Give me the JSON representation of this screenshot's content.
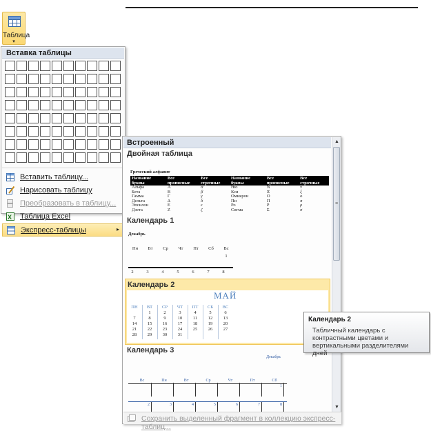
{
  "ribbon": {
    "table_button_label": "Таблица",
    "table_button_arrow": "▾"
  },
  "insert_menu": {
    "header": "Вставка таблицы",
    "grid": {
      "columns": 10,
      "rows": 8
    },
    "items": [
      {
        "label": "Вставить таблицу...",
        "icon": "insert-table-icon",
        "disabled": false
      },
      {
        "label": "Нарисовать таблицу",
        "icon": "draw-table-icon",
        "disabled": false
      },
      {
        "label": "Преобразовать в таблицу...",
        "icon": "convert-to-table-icon",
        "disabled": true
      },
      {
        "label": "Таблица Excel",
        "icon": "excel-icon",
        "disabled": false
      },
      {
        "label": "Экспресс-таблицы",
        "icon": "quick-tables-icon",
        "disabled": false,
        "highlighted": true,
        "submenu": "▸"
      }
    ]
  },
  "gallery": {
    "header": "Встроенный",
    "items": [
      {
        "title": "Двойная таблица"
      },
      {
        "title": "Календарь 1"
      },
      {
        "title": "Календарь 2",
        "selected": true
      },
      {
        "title": "Календарь 3"
      }
    ],
    "footer": "Сохранить выделенный фрагмент в коллекцию экспресс-таблиц..."
  },
  "greek_table": {
    "caption": "Греческий алфавит",
    "headers": [
      "Название буквы",
      "Все прописные",
      "Все строчные",
      "Название буквы",
      "Все прописные",
      "Все строчные"
    ],
    "rows": [
      [
        "Альфа",
        "А",
        "α",
        "Ню",
        "N",
        "ν"
      ],
      [
        "Бета",
        "В",
        "β",
        "Кси",
        "Ξ",
        "ξ"
      ],
      [
        "Гамма",
        "Г",
        "γ",
        "Омикрон",
        "О",
        "ο"
      ],
      [
        "Дельта",
        "Δ",
        "δ",
        "Пи",
        "П",
        "π"
      ],
      [
        "Эпсилон",
        "Е",
        "ε",
        "Ро",
        "Р",
        "ρ"
      ],
      [
        "Дзета",
        "Z",
        "ζ",
        "Сигма",
        "Σ",
        "σ"
      ]
    ]
  },
  "calendar1": {
    "month": "Декабрь",
    "days": [
      "Пн",
      "Вт",
      "Ср",
      "Чт",
      "Пт",
      "Сб",
      "Вс"
    ],
    "week0": [
      "",
      "",
      "",
      "",
      "",
      "",
      "1"
    ],
    "week1": [
      "2",
      "3",
      "4",
      "5",
      "6",
      "7",
      "8"
    ]
  },
  "calendar2": {
    "month": "МАЙ",
    "days": [
      "ПН",
      "ВТ",
      "СР",
      "ЧТ",
      "ПТ",
      "СБ",
      "ВС"
    ],
    "weeks": [
      [
        "",
        "1",
        "2",
        "3",
        "4",
        "5",
        "6"
      ],
      [
        "7",
        "8",
        "9",
        "10",
        "11",
        "12",
        "13"
      ],
      [
        "14",
        "15",
        "16",
        "17",
        "18",
        "19",
        "20"
      ],
      [
        "21",
        "22",
        "23",
        "24",
        "25",
        "26",
        "27"
      ],
      [
        "28",
        "29",
        "30",
        "31",
        "",
        "",
        ""
      ]
    ]
  },
  "calendar3": {
    "month": "Декабрь",
    "days": [
      "Вс",
      "Пн",
      "Вт",
      "Ср",
      "Чт",
      "Пт",
      "Сб"
    ],
    "week0": [
      "",
      "",
      "",
      "",
      "",
      "",
      "1"
    ],
    "week1": [
      "2",
      "3",
      "4",
      "5",
      "6",
      "7",
      "8"
    ]
  },
  "tooltip": {
    "title": "Календарь 2",
    "description": "Табличный календарь с контрастными цветами и вертикальными разделителями дней"
  },
  "colors": {
    "highlight": "#fde9a8",
    "accent": "#4f81bd",
    "header_bg": "#dde4ee"
  }
}
